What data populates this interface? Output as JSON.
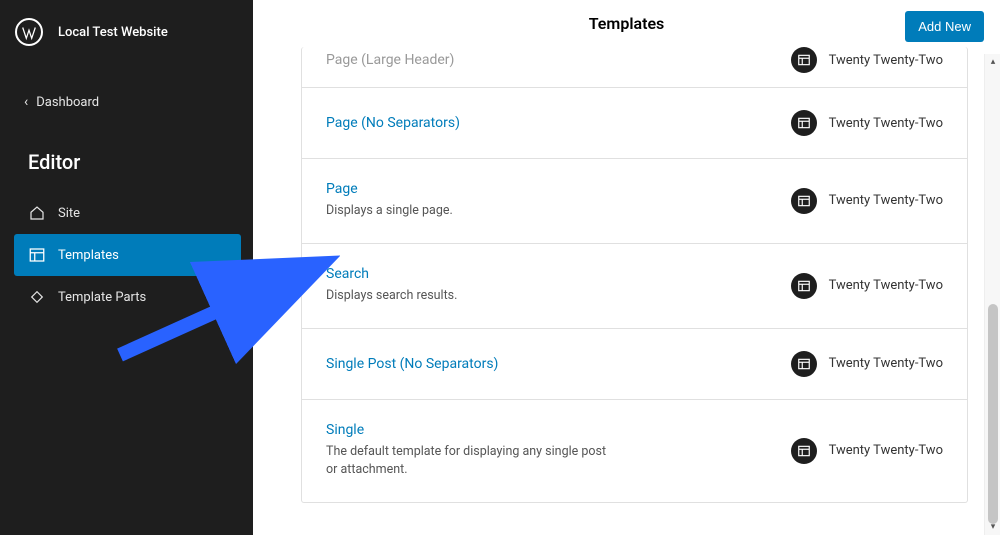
{
  "site_name": "Local Test Website",
  "dashboard_label": "Dashboard",
  "editor_title": "Editor",
  "nav": {
    "site": "Site",
    "templates": "Templates",
    "template_parts": "Template Parts"
  },
  "main_title": "Templates",
  "add_new_label": "Add New",
  "templates": [
    {
      "name": "Page (Large Header)",
      "desc": "",
      "theme": "Twenty Twenty-Two"
    },
    {
      "name": "Page (No Separators)",
      "desc": "",
      "theme": "Twenty Twenty-Two"
    },
    {
      "name": "Page",
      "desc": "Displays a single page.",
      "theme": "Twenty Twenty-Two"
    },
    {
      "name": "Search",
      "desc": "Displays search results.",
      "theme": "Twenty Twenty-Two"
    },
    {
      "name": "Single Post (No Separators)",
      "desc": "",
      "theme": "Twenty Twenty-Two"
    },
    {
      "name": "Single",
      "desc": "The default template for displaying any single post or attachment.",
      "theme": "Twenty Twenty-Two"
    }
  ]
}
